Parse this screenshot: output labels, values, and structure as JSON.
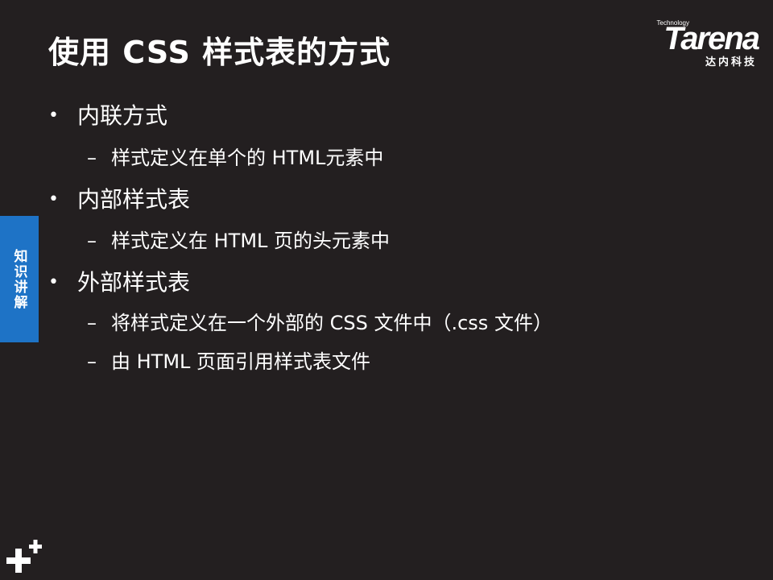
{
  "slide": {
    "title": "使用 CSS 样式表的方式",
    "logo": {
      "technology": "Technology",
      "brand": "Tarena",
      "chinese": "达内科技"
    },
    "side_tab": "知识讲解",
    "bullet_glyph": "•",
    "dash_glyph": "–",
    "items": [
      {
        "text": "内联方式",
        "level": 1
      },
      {
        "text": "样式定义在单个的 HTML元素中",
        "level": 2
      },
      {
        "text": "内部样式表",
        "level": 1
      },
      {
        "text": "样式定义在 HTML 页的头元素中",
        "level": 2
      },
      {
        "text": "外部样式表",
        "level": 1
      },
      {
        "text": "将样式定义在一个外部的 CSS 文件中（.css 文件）",
        "level": 2
      },
      {
        "text": "由 HTML 页面引用样式表文件",
        "level": 2
      }
    ]
  }
}
